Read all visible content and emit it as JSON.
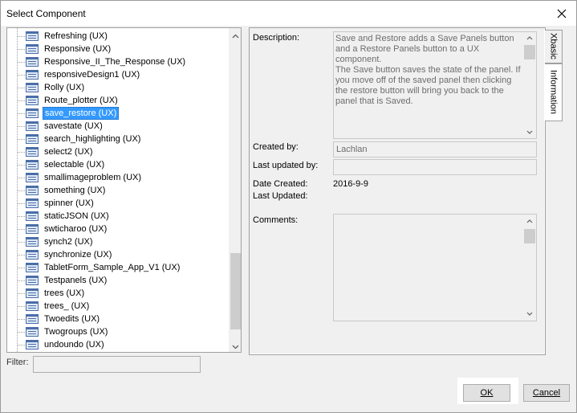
{
  "window": {
    "title": "Select Component"
  },
  "tree": {
    "items": [
      {
        "label": "Refreshing (UX)"
      },
      {
        "label": "Responsive (UX)"
      },
      {
        "label": "Responsive_II_The_Response (UX)"
      },
      {
        "label": "responsiveDesign1 (UX)"
      },
      {
        "label": "Rolly (UX)"
      },
      {
        "label": "Route_plotter (UX)"
      },
      {
        "label": "save_restore (UX)",
        "selected": true
      },
      {
        "label": "savestate (UX)"
      },
      {
        "label": "search_highlighting (UX)"
      },
      {
        "label": "select2 (UX)"
      },
      {
        "label": "selectable (UX)"
      },
      {
        "label": "smallimageproblem (UX)"
      },
      {
        "label": "something (UX)"
      },
      {
        "label": "spinner (UX)"
      },
      {
        "label": "staticJSON (UX)"
      },
      {
        "label": "swticharoo (UX)"
      },
      {
        "label": "synch2 (UX)"
      },
      {
        "label": "synchronize (UX)"
      },
      {
        "label": "TabletForm_Sample_App_V1 (UX)"
      },
      {
        "label": "Testpanels (UX)"
      },
      {
        "label": "trees (UX)"
      },
      {
        "label": "trees_ (UX)"
      },
      {
        "label": "Twoedits (UX)"
      },
      {
        "label": "Twogroups (UX)"
      },
      {
        "label": "undoundo (UX)"
      }
    ]
  },
  "filter": {
    "label": "Filter:",
    "value": ""
  },
  "info": {
    "description_label": "Description:",
    "description_text": "Save and Restore adds a Save Panels button and a Restore Panels button to a UX component.\nThe Save button saves the state of the panel. If you move off of the saved panel then clicking the restore button will bring you back to the panel that is Saved.",
    "created_by_label": "Created by:",
    "created_by_value": "Lachlan",
    "last_updated_by_label": "Last updated by:",
    "last_updated_by_value": "",
    "date_created_label": "Date Created:",
    "date_created_value": "2016-9-9",
    "last_updated_label": "Last Updated:",
    "last_updated_value": "",
    "comments_label": "Comments:",
    "comments_value": ""
  },
  "tabs": [
    {
      "label": "Xbasic"
    },
    {
      "label": "Information",
      "active": true
    }
  ],
  "buttons": {
    "ok": "OK",
    "cancel": "Cancel"
  },
  "icons": {
    "close": "close-icon",
    "component": "component-icon",
    "scroll_up": "chevron-up-icon",
    "scroll_down": "chevron-down-icon"
  },
  "colors": {
    "selection": "#3399ff",
    "panel": "#f0f0f0"
  }
}
